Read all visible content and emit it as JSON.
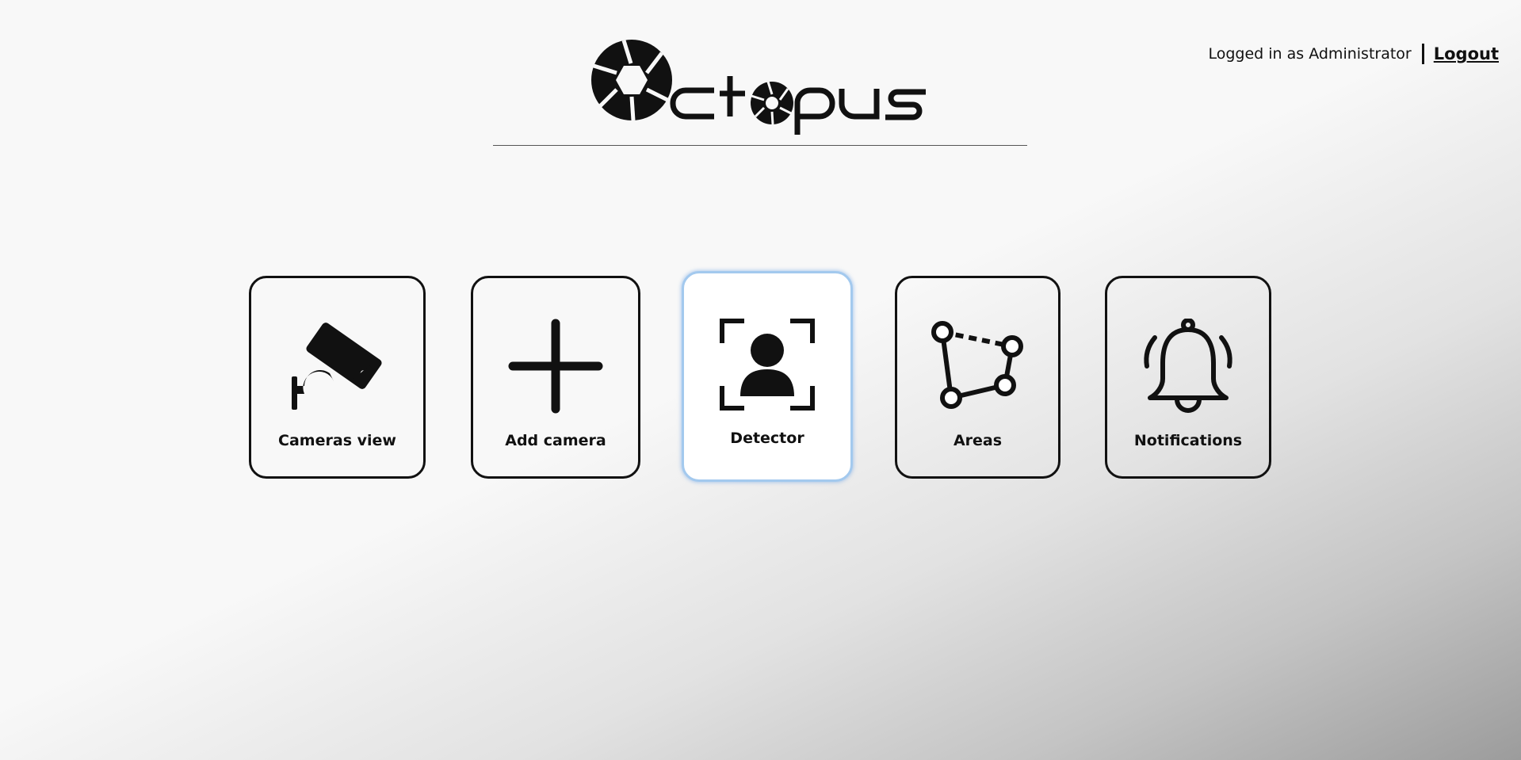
{
  "app": {
    "logo_text": "Octopus"
  },
  "session": {
    "logged_in_text": "Logged in as Administrator",
    "separator": "|",
    "logout_label": "Logout"
  },
  "menu": {
    "tiles": [
      {
        "label": "Cameras view",
        "icon": "security-camera-icon",
        "active": false
      },
      {
        "label": "Add camera",
        "icon": "plus-icon",
        "active": false
      },
      {
        "label": "Detector",
        "icon": "face-detection-icon",
        "active": true
      },
      {
        "label": "Areas",
        "icon": "polygon-area-icon",
        "active": false
      },
      {
        "label": "Notifications",
        "icon": "bell-icon",
        "active": false
      }
    ]
  },
  "colors": {
    "active_border": "#a3c9ee",
    "tile_border": "#111111"
  }
}
